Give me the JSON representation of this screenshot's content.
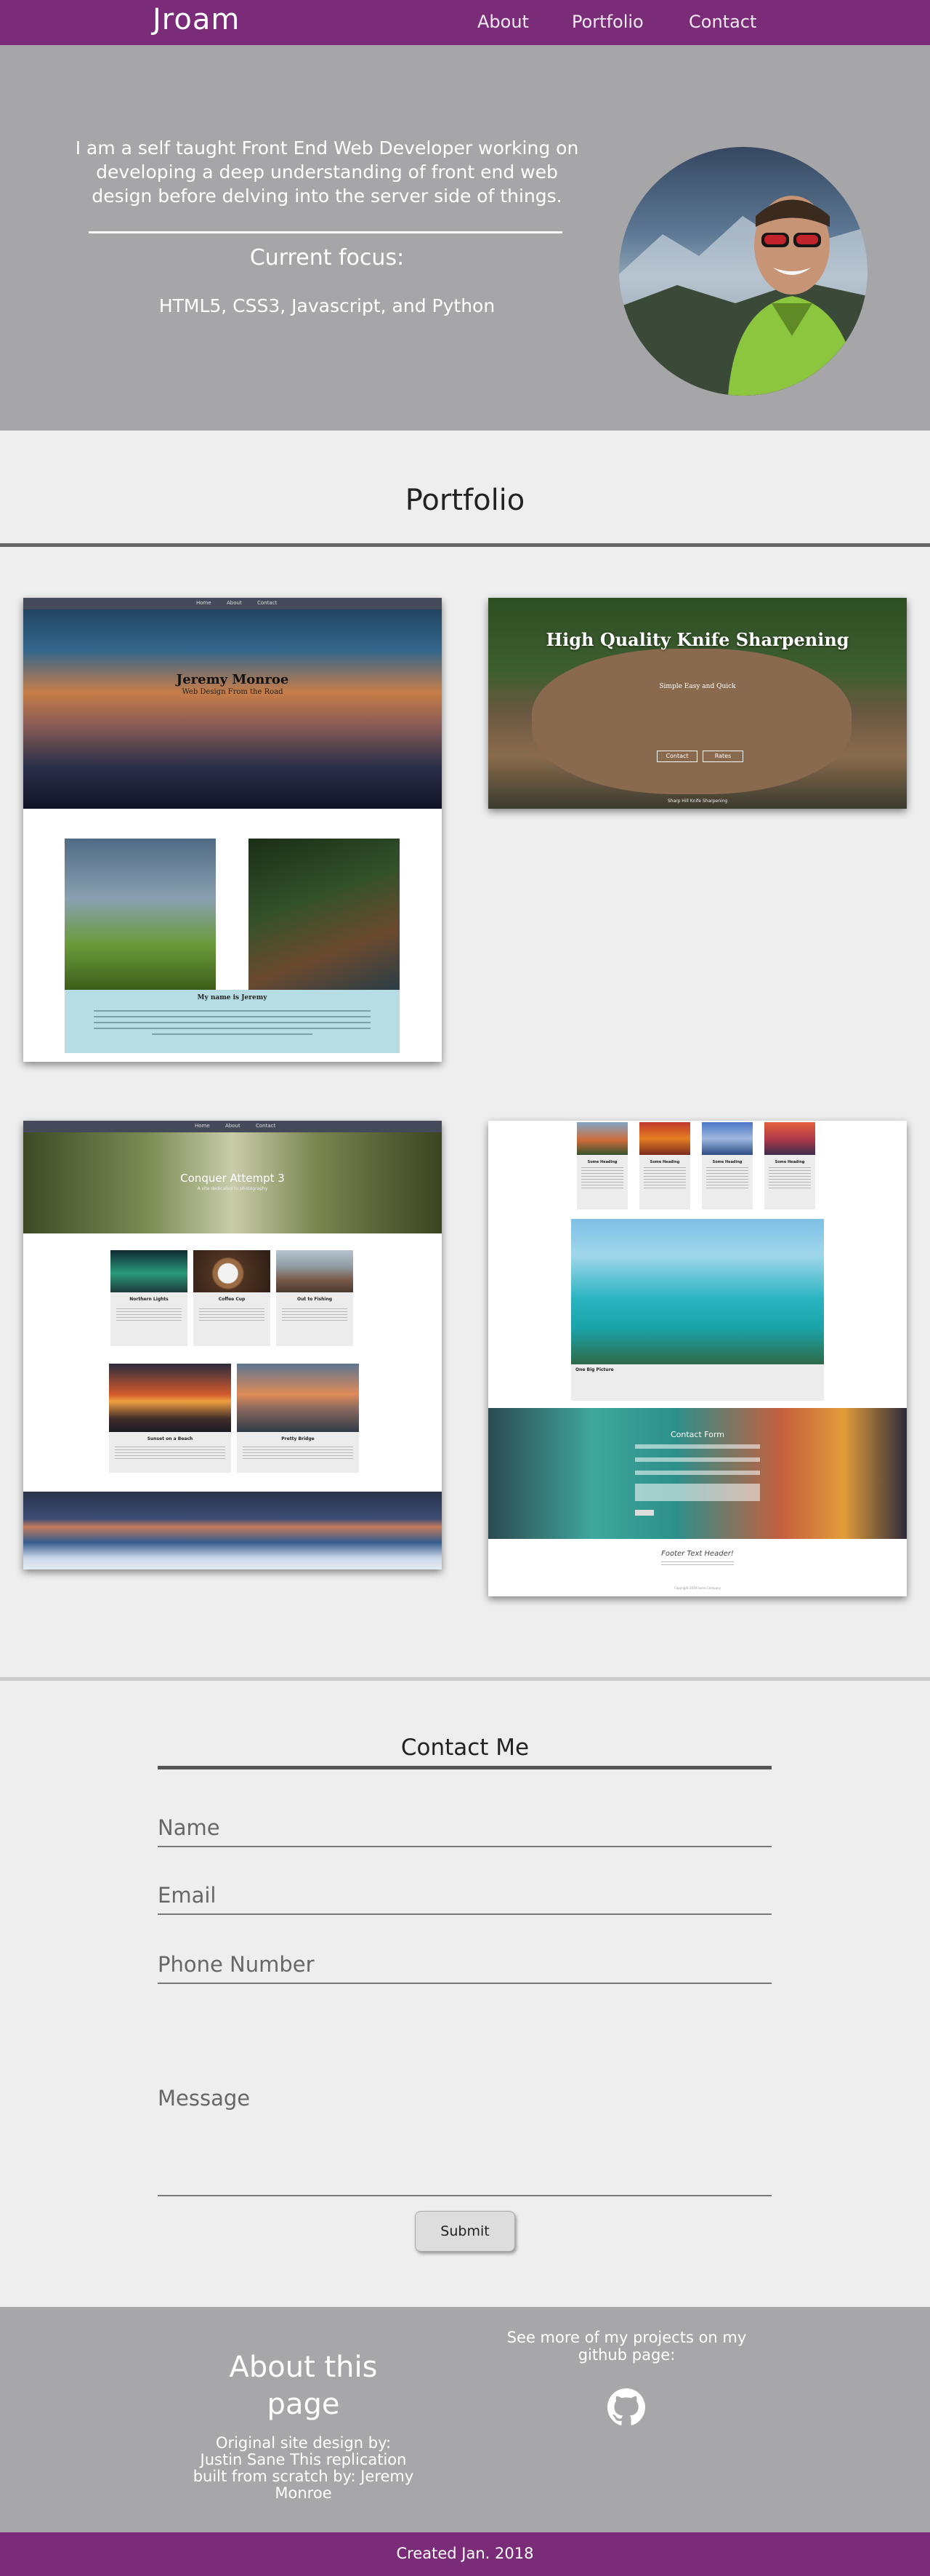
{
  "nav": {
    "brand": "Jroam",
    "links": [
      "About",
      "Portfolio",
      "Contact"
    ]
  },
  "hero": {
    "intro": "I am a self taught Front End Web Developer working on developing a deep understanding of front end web design before delving into the server side of things.",
    "focus_title": "Current focus:",
    "focus_list": "HTML5, CSS3, Javascript, and Python"
  },
  "portfolio": {
    "title": "Portfolio",
    "card1": {
      "nav_links": [
        "Home",
        "About",
        "Contact"
      ],
      "title": "Jeremy Monroe",
      "subtitle": "Web Design From the Road",
      "bio_title": "My name is Jeremy"
    },
    "card2": {
      "title": "High Quality Knife Sharpening",
      "tagline": "Simple Easy and Quick",
      "buttons": [
        "Contact",
        "Rates"
      ],
      "footer": "Sharp Hill Knife Sharpening"
    },
    "card3": {
      "nav_links": [
        "Home",
        "About",
        "Contact"
      ],
      "title": "Conquer Attempt 3",
      "subtitle": "A site dedicated to photography",
      "tiles": [
        "Northern Lights",
        "Coffee Cup",
        "Out to Fishing",
        "Sunset on a Beach",
        "Pretty Bridge"
      ]
    },
    "card4": {
      "tiles": [
        "Some Heading",
        "Some Heading",
        "Some Heading",
        "Some Heading"
      ],
      "photo_caption": "One Big Picture",
      "contact_title": "Contact Form",
      "footer_header": "Footer Text Header!",
      "copyright": "Copyright 2018 Some Company"
    }
  },
  "contact": {
    "title": "Contact Me",
    "name_placeholder": "Name",
    "email_placeholder": "Email",
    "phone_placeholder": "Phone Number",
    "message_placeholder": "Message",
    "submit_label": "Submit"
  },
  "footer": {
    "about_title": "About this page",
    "credit": "Original site design by: Justin Sane This replication built from scratch by: Jeremy Monroe",
    "github_text": "See more of my projects on my github page:",
    "github_icon": "github-icon",
    "created": "Created Jan. 2018"
  },
  "colors": {
    "nav_bg": "#7a2c78",
    "hero_bg": "#a6a6a8",
    "page_bg": "#eeeeee"
  }
}
